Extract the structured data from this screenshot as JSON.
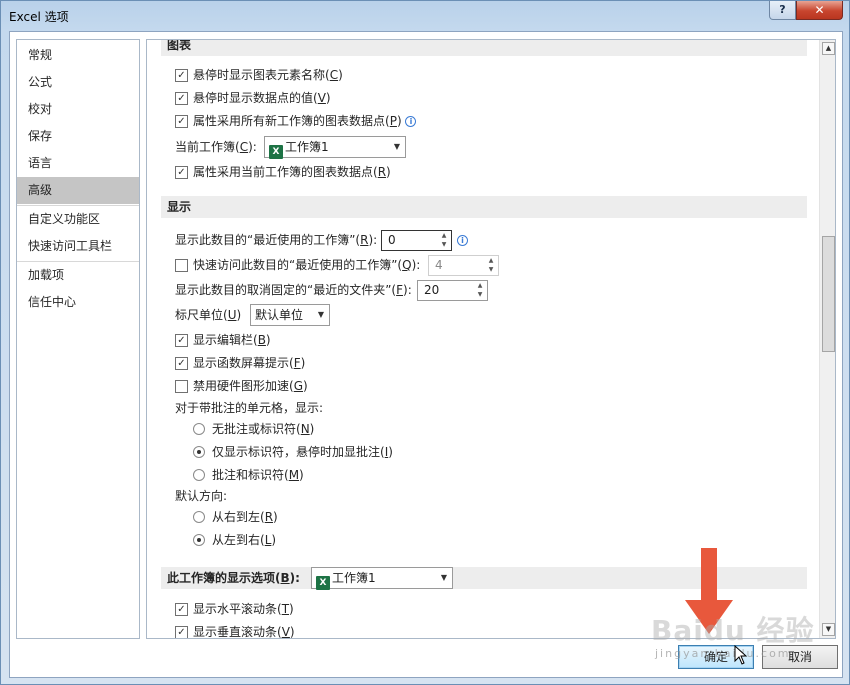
{
  "window": {
    "title": "Excel 选项",
    "help_label": "?",
    "close_label": "✕"
  },
  "nav": {
    "items": [
      {
        "label": "常规"
      },
      {
        "label": "公式"
      },
      {
        "label": "校对"
      },
      {
        "label": "保存"
      },
      {
        "label": "语言"
      },
      {
        "label": "高级",
        "selected": true
      },
      {
        "label": "自定义功能区"
      },
      {
        "label": "快速访问工具栏"
      },
      {
        "label": "加载项"
      },
      {
        "label": "信任中心"
      }
    ]
  },
  "chart_section": {
    "header": "图表",
    "opt1": {
      "checked": true,
      "text": "悬停时显示图表元素名称(",
      "key": "C",
      "tail": ")"
    },
    "opt2": {
      "checked": true,
      "text": "悬停时显示数据点的值(",
      "key": "V",
      "tail": ")"
    },
    "opt3": {
      "checked": true,
      "text": "属性采用所有新工作簿的图表数据点(",
      "key": "P",
      "tail": ")"
    },
    "current_wb_label": "当前工作簿(",
    "current_wb_key": "C",
    "current_wb_tail": "):",
    "current_wb_value": "工作簿1",
    "opt4": {
      "checked": true,
      "text": "属性采用当前工作簿的图表数据点(",
      "key": "R",
      "tail": ")"
    }
  },
  "display_section": {
    "header": "显示",
    "recent_wb_label": "显示此数目的“最近使用的工作簿”(",
    "recent_wb_key": "R",
    "recent_wb_tail": "):",
    "recent_wb_value": "0",
    "quick_access": {
      "checked": false,
      "text": "快速访问此数目的“最近使用的工作簿”(",
      "key": "Q",
      "tail": "):",
      "value": "4"
    },
    "unpinned_label": "显示此数目的取消固定的“最近的文件夹”(",
    "unpinned_key": "F",
    "unpinned_tail": "):",
    "unpinned_value": "20",
    "ruler_label": "标尺单位(",
    "ruler_key": "U",
    "ruler_tail": ")",
    "ruler_value": "默认单位",
    "show_formula_bar": {
      "checked": true,
      "text": "显示编辑栏(",
      "key": "B",
      "tail": ")"
    },
    "show_func_tips": {
      "checked": true,
      "text": "显示函数屏幕提示(",
      "key": "F",
      "tail": ")"
    },
    "disable_hw_accel": {
      "checked": false,
      "text": "禁用硬件图形加速(",
      "key": "G",
      "tail": ")"
    },
    "comments_label": "对于带批注的单元格，显示:",
    "comment_opt1": {
      "selected": false,
      "text": "无批注或标识符(",
      "key": "N",
      "tail": ")"
    },
    "comment_opt2": {
      "selected": true,
      "text": "仅显示标识符，悬停时加显批注(",
      "key": "I",
      "tail": ")"
    },
    "comment_opt3": {
      "selected": false,
      "text": "批注和标识符(",
      "key": "M",
      "tail": ")"
    },
    "direction_label": "默认方向:",
    "dir_opt1": {
      "selected": false,
      "text": "从右到左(",
      "key": "R",
      "tail": ")"
    },
    "dir_opt2": {
      "selected": true,
      "text": "从左到右(",
      "key": "L",
      "tail": ")"
    }
  },
  "workbook_section": {
    "header": "此工作簿的显示选项(",
    "header_key": "B",
    "header_tail": "):",
    "workbook_value": "工作簿1",
    "show_hscroll": {
      "checked": true,
      "text": "显示水平滚动条(",
      "key": "T",
      "tail": ")"
    },
    "show_vscroll": {
      "checked": true,
      "text": "显示垂直滚动条(",
      "key": "V",
      "tail": ")"
    }
  },
  "buttons": {
    "ok": "确定",
    "cancel": "取消"
  },
  "watermark": {
    "text": "Baidu 经验",
    "sub": "jingyan.baidu.com"
  },
  "colors": {
    "accent_arrow": "#e8583c",
    "excel_green": "#1d7345",
    "selected_nav": "#c5c5c5"
  }
}
